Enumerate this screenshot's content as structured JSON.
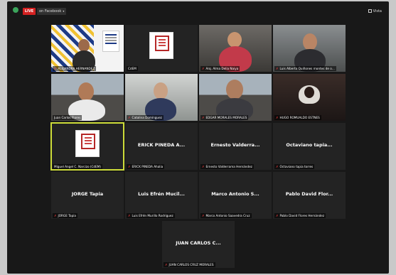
{
  "topbar": {
    "live_label": "LIVE",
    "live_destination": "on Facebook",
    "view_label": "Vista"
  },
  "participants": [
    {
      "name": "ALEJANDRA HERNANDEZ",
      "muted": true,
      "video": "brand"
    },
    {
      "name": "CdEM",
      "muted": false,
      "video": "logo"
    },
    {
      "name": "Arq. Alma Delia Naiya",
      "muted": true,
      "video": "office"
    },
    {
      "name": "Luis Alberto Quiñones montes de o...",
      "muted": true,
      "video": "room"
    },
    {
      "name": "Juan Carlos Flores",
      "muted": false,
      "video": "window"
    },
    {
      "name": "Catalina Domínguez",
      "muted": true,
      "video": "bright"
    },
    {
      "name": "EDGAR MORALES MORALES",
      "muted": true,
      "video": "window"
    },
    {
      "name": "HUGO ROMUALDO ESTNES",
      "muted": true,
      "video": "dark"
    },
    {
      "name": "Miguel Angel C. Narcizo (CdEM)",
      "muted": false,
      "video": "logo",
      "active": true
    },
    {
      "name": "ERICK PINEDA Ahalia",
      "muted": true,
      "display": "ERICK PINEDA A..."
    },
    {
      "name": "Ernesto Valderrama Hernández",
      "muted": true,
      "display": "Ernesto Valderra..."
    },
    {
      "name": "Octaviano tapia torres",
      "muted": true,
      "display": "Octaviano tapia..."
    },
    {
      "name": "JORGE Tapia",
      "muted": true,
      "display": "JORGE Tapia"
    },
    {
      "name": "Luis Efrén Murillo Rodriguez",
      "muted": true,
      "display": "Luis Efrén Mucil..."
    },
    {
      "name": "Marco Antonio Saavedra Cruz",
      "muted": true,
      "display": "Marco Antonio S..."
    },
    {
      "name": "Pablo David Flores Hernández",
      "muted": true,
      "display": "Pablo David Flor..."
    },
    {
      "name": "JUAN CARLOS CRUZ MORALES",
      "muted": true,
      "display": "JUAN CARLOS C..."
    }
  ],
  "icons": {
    "mic_muted": "mic-muted-icon",
    "mic_glyph": "✗"
  },
  "colors": {
    "live_red": "#d32121",
    "active_speaker": "#cddc39",
    "muted_red": "#e23a3a"
  }
}
